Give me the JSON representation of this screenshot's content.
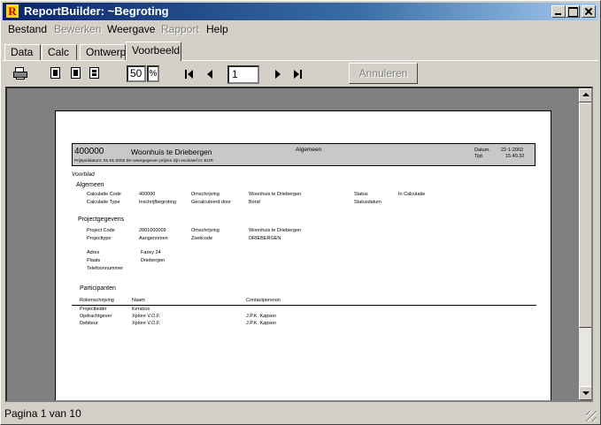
{
  "window": {
    "title": "ReportBuilder: ~Begroting",
    "app_icon_letter": "R"
  },
  "menu": [
    {
      "label": "Bestand",
      "disabled": false
    },
    {
      "label": "Bewerken",
      "disabled": true
    },
    {
      "label": "Weergave",
      "disabled": false
    },
    {
      "label": "Rapport",
      "disabled": true
    },
    {
      "label": "Help",
      "disabled": false
    }
  ],
  "tabs": [
    {
      "label": "Data",
      "active": false
    },
    {
      "label": "Calc",
      "active": false
    },
    {
      "label": "Ontwerp",
      "active": false
    },
    {
      "label": "Voorbeeld",
      "active": true
    }
  ],
  "toolbar": {
    "zoom_value": "50",
    "zoom_unit": "%",
    "page_number": "1",
    "cancel_label": "Annuleren",
    "icons": [
      "print-icon",
      "one-page-icon",
      "two-page-icon",
      "multi-page-icon",
      "first-page-icon",
      "prev-page-icon",
      "next-page-icon",
      "last-page-icon"
    ]
  },
  "report": {
    "header": {
      "code": "400000",
      "title": "Woonhuis te Driebergen",
      "category": "Algemeen",
      "date_label": "Datum.",
      "date_value": "22-1-2002",
      "time_label": "Tijd.",
      "time_value": "15.40.32",
      "subline": "Prijspeildatum: 01-01-2002    De weergegeven prijzen zijn exclusief in:  EUR"
    },
    "section_voorblad": "Voorblad",
    "section_algemeen": "Algemeen",
    "algemeen_fields": {
      "calc_code_label": "Calculatie Code",
      "calc_code_value": "400000",
      "omschrijving_label": "Omschrijving",
      "omschrijving_value": "Woonhuis te Driebergen",
      "status_label": "Status",
      "status_value": "In Calculatie",
      "calc_type_label": "Calculatie Type",
      "calc_type_value": "Inschrijfbegroting",
      "gecalculeerd_label": "Gecalculeerd door",
      "gecalculeerd_value": "Bond",
      "statusdatum_label": "Statusdatum"
    },
    "section_projectgegevens": "Projectgegevens",
    "project_fields": {
      "project_code_label": "Project Code",
      "project_code_value": "2001000009",
      "omschrijving_label": "Omschrijving",
      "omschrijving_value": "Woonhuis te Driebergen",
      "projecttype_label": "Projecttype",
      "projecttype_value": "Aangenomen",
      "zoekcode_label": "Zoekcode",
      "zoekcode_value": "DRIEBERGEN",
      "adres_label": "Adres",
      "adres_value": "Fazey 24",
      "plaats_label": "Plaats",
      "plaats_value": "Driebergen",
      "telefoon_label": "Telefoonnummer"
    },
    "section_participanten": "Participanten",
    "participanten": {
      "headers": [
        "Rolomschrijving",
        "Naam",
        "Contactpersoon"
      ],
      "rows": [
        {
          "rol": "Projectleider",
          "naam": "Kersbos",
          "contact": ""
        },
        {
          "rol": "Opdrachtgever",
          "naam": "Xplore V.O.F.",
          "contact": "J.P.K.      Kapsen"
        },
        {
          "rol": "Debiteur",
          "naam": "Xplore V.O.F.",
          "contact": "J.P.K.      Kapsen"
        }
      ]
    }
  },
  "status_bar": {
    "text": "Pagina 1 van 10"
  }
}
